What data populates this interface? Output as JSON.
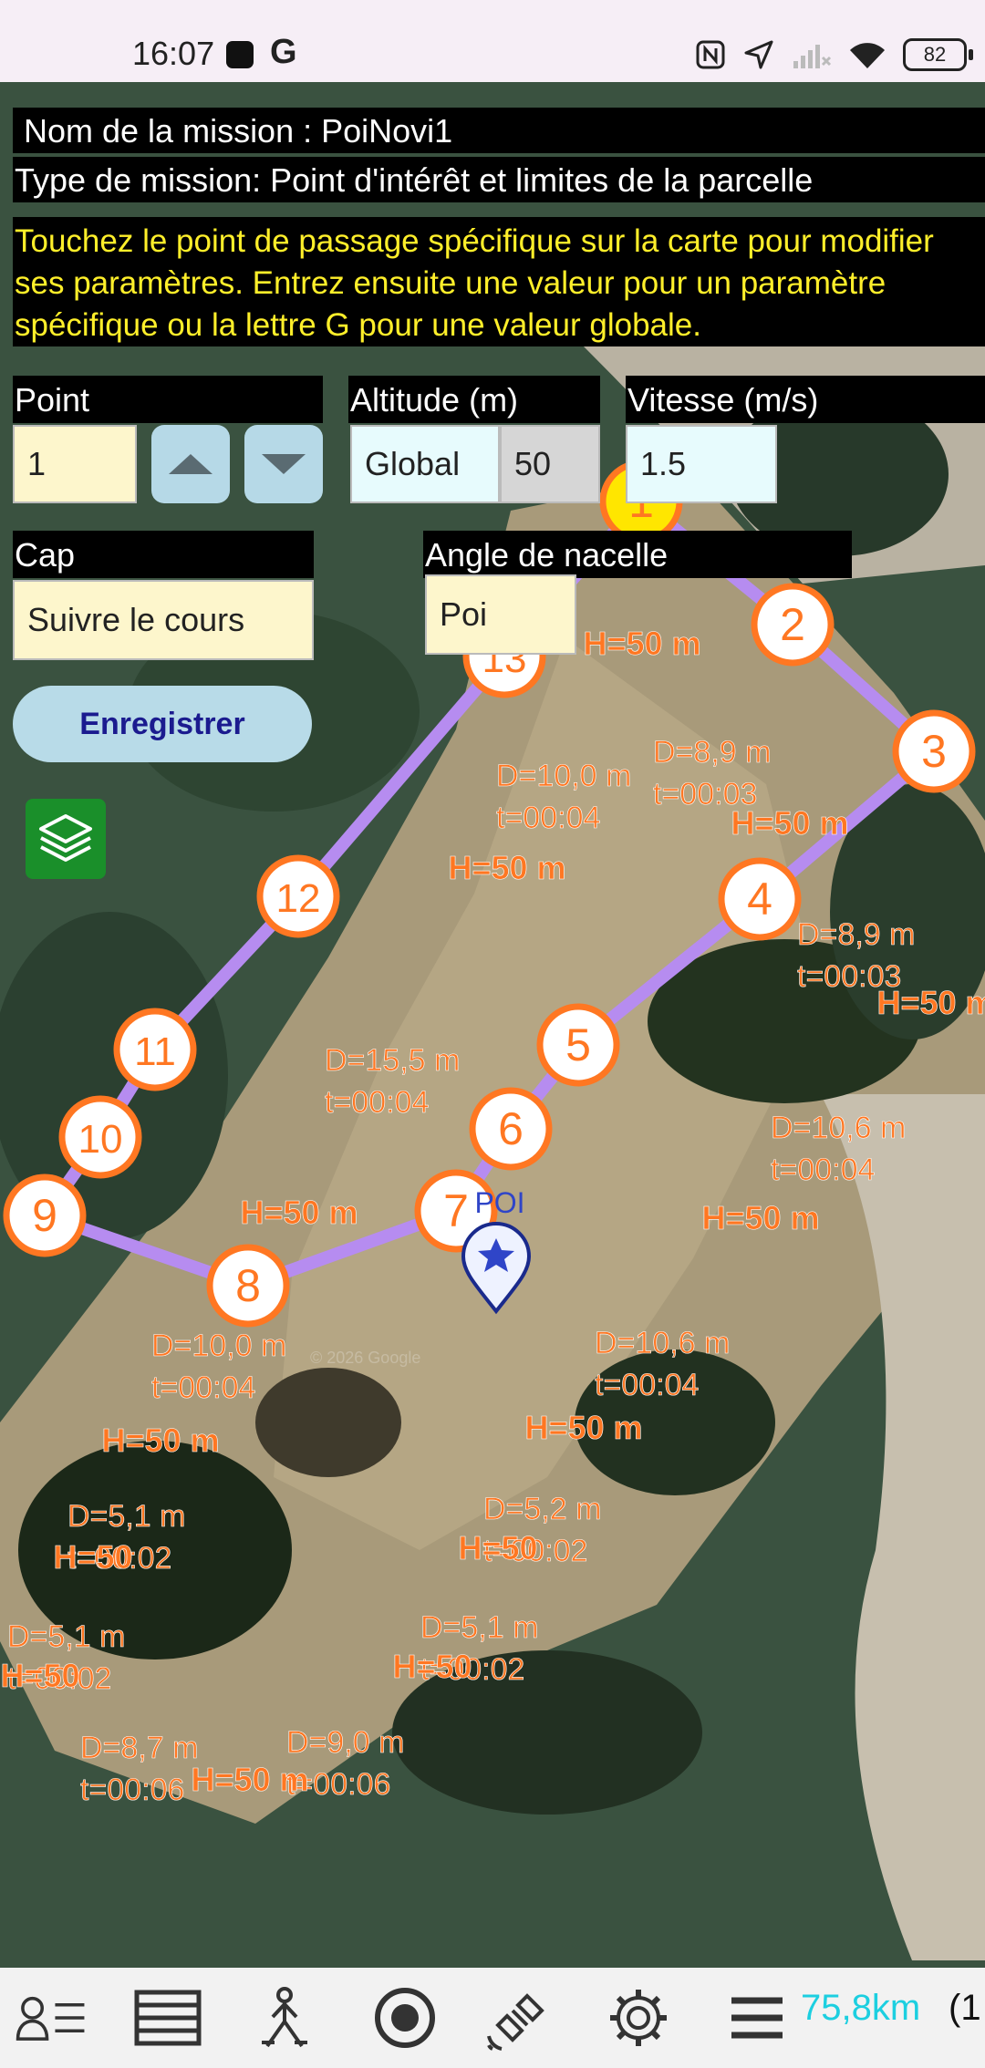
{
  "status_bar": {
    "time": "16:07",
    "battery": "82"
  },
  "mission": {
    "name_line": "Nom de la mission : PoiNovi1",
    "type_line": "Type de mission: Point d'intérêt et limites de la parcelle",
    "instructions": "Touchez le point de passage spécifique sur la carte pour modifier ses paramètres. Entrez ensuite une valeur pour un paramètre spécifique ou la lettre G pour une valeur globale."
  },
  "form": {
    "point_label": "Point",
    "point_value": "1",
    "altitude_label": "Altitude (m)",
    "altitude_mode": "Global",
    "altitude_value": "50",
    "speed_label": "Vitesse (m/s)",
    "speed_value": "1.5",
    "heading_label": "Cap",
    "heading_value": "Suivre le cours",
    "gimbal_label": "Angle de nacelle",
    "gimbal_value": "Poi",
    "save_label": "Enregistrer"
  },
  "map": {
    "poi_label": "POI",
    "watermark": "© 2026 Google",
    "waypoints": [
      "1",
      "2",
      "3",
      "4",
      "5",
      "6",
      "7",
      "8",
      "9",
      "10",
      "11",
      "12",
      "13"
    ],
    "height_labels": [
      "H=50 m",
      "H=50 m",
      "H=50 m",
      "H=50 m",
      "H=50 m",
      "H=50",
      "H=50",
      "H=50 m",
      "H=50",
      "H=50",
      "H=50 m",
      "H=50 m",
      "H=50 m"
    ],
    "segments": [
      {
        "d": "D=8,9 m",
        "t": "t=00:03"
      },
      {
        "d": "D=8,9 m",
        "t": "t=00:03"
      },
      {
        "d": "D=10,6 m",
        "t": "t=00:04"
      },
      {
        "d": "D=10,6 m",
        "t": "t=00:04"
      },
      {
        "d": "D=5,2 m",
        "t": "t=00:02"
      },
      {
        "d": "D=5,1 m",
        "t": "t=00:02"
      },
      {
        "d": "D=9,0 m",
        "t": "t=00:06"
      },
      {
        "d": "D=8,7 m",
        "t": "t=00:06"
      },
      {
        "d": "D=5,1 m",
        "t": "t=00:02"
      },
      {
        "d": "D=5,1 m",
        "t": "t=00:02"
      },
      {
        "d": "D=10,0 m",
        "t": "t=00:04"
      },
      {
        "d": "D=15,5 m",
        "t": "t=00:04"
      },
      {
        "d": "D=10,0 m",
        "t": "t=00:04"
      }
    ],
    "colors": {
      "path": "#b68cf0",
      "marker_ring": "#ff7722",
      "label": "#ff7722",
      "selected": "#ffe600",
      "poi": "#2f45c8"
    }
  },
  "bottom_bar": {
    "icons": [
      "user-list-icon",
      "table-icon",
      "surveyor-icon",
      "record-icon",
      "satellite-icon",
      "settings-icon",
      "menu-icon"
    ],
    "distance": "75,8km",
    "distance_extra": "(1"
  }
}
